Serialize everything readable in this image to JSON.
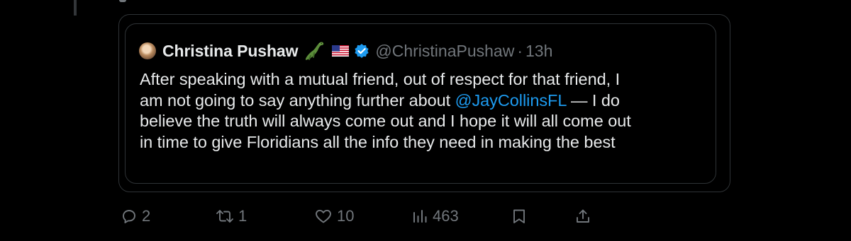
{
  "quote": {
    "display_name": "Christina Pushaw",
    "emoji": [
      "alligator-icon",
      "us-flag-icon"
    ],
    "handle": "@ChristinaPushaw",
    "separator": "·",
    "time": "13h",
    "body": {
      "line1": "After speaking with a mutual friend, out of respect for that friend, I",
      "line2_pre": "am not going to say anything further about ",
      "mention": "@JayCollinsFL",
      "line2_post": " — I do",
      "line3": "believe the truth will always come out and I hope it will all come out",
      "line4": "in time to give Floridians all the info they need in making the best"
    }
  },
  "actions": {
    "replies": "2",
    "reposts": "1",
    "likes": "10",
    "views": "463"
  },
  "colors": {
    "background": "#000000",
    "text": "#e7e9ea",
    "muted": "#71767b",
    "link": "#1d9bf0",
    "border": "#2f3336"
  }
}
